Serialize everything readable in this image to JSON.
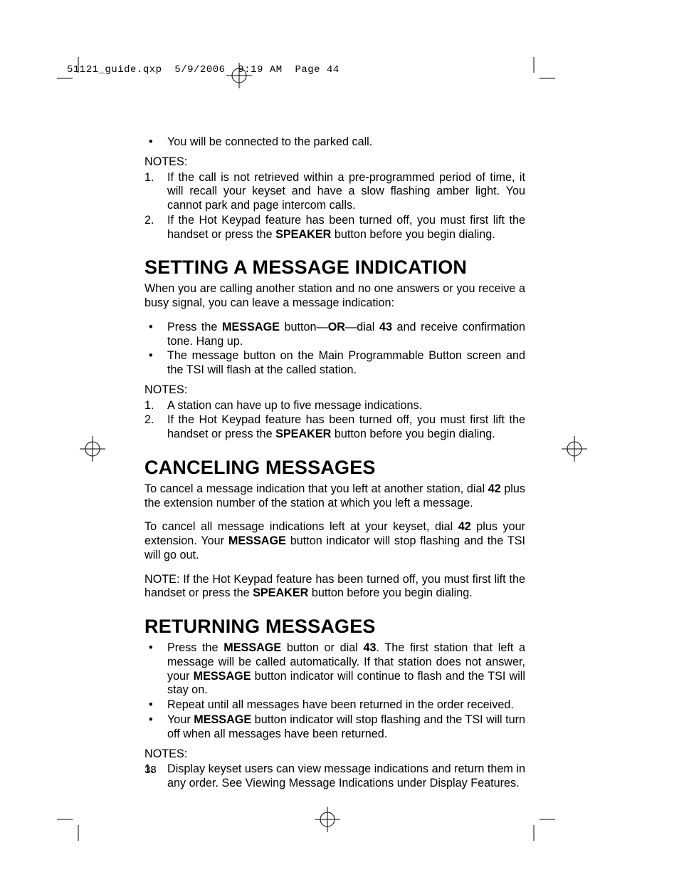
{
  "slug": "51121_guide.qxp  5/9/2006  9:19 AM  Page 44",
  "page_number": "38",
  "intro_bullets": [
    "You will be connected to the parked call."
  ],
  "intro_notes_label": "NOTES:",
  "intro_notes": [
    "If the call is not retrieved within a pre-programmed period of time, it will recall your keyset and have a slow flashing amber light. You cannot park and page intercom calls.",
    {
      "pre": "If the Hot Keypad feature has been turned off, you must first lift the handset or press the ",
      "bold": "SPEAKER",
      "post": " button before you begin dialing."
    }
  ],
  "sec1_title": "SETTING A MESSAGE INDICATION",
  "sec1_intro": "When you are calling another station and no one answers or you receive a busy signal, you can leave a message indication:",
  "sec1_bullets": [
    {
      "pre": "Press the ",
      "b1": "MESSAGE",
      "mid1": " button—",
      "b2": "OR",
      "mid2": "—dial ",
      "b3": "43",
      "post": " and receive confirmation tone. Hang up."
    },
    "The message button on the Main Programmable Button screen and the TSI will flash at the called station."
  ],
  "sec1_notes_label": "NOTES:",
  "sec1_notes": [
    "A station can have up to five message indications.",
    {
      "pre": "If the Hot Keypad feature has been turned off, you must first lift the handset or press the ",
      "bold": "SPEAKER",
      "post": " button before you begin dialing."
    }
  ],
  "sec2_title": "CANCELING MESSAGES",
  "sec2_p1": {
    "pre": "To cancel a message indication that you left at another station, dial ",
    "bold": "42",
    "post": " plus the extension number of the station at which you left a message."
  },
  "sec2_p2": {
    "pre": "To cancel all message indications left at your keyset, dial ",
    "b1": "42",
    "mid": " plus your extension. Your ",
    "b2": "MESSAGE",
    "post": " button indicator will stop flashing and the TSI will go out."
  },
  "sec2_note": {
    "pre": "NOTE: If the Hot Keypad feature has been turned off, you must first lift the handset or press the ",
    "bold": "SPEAKER",
    "post": " button before you begin dialing."
  },
  "sec3_title": "RETURNING MESSAGES",
  "sec3_bullets": [
    {
      "pre": "Press the ",
      "b1": "MESSAGE",
      "mid1": " button or dial ",
      "b2": "43",
      "mid2": ". The first station that left a message will be called automatically. If that station does not answer, your ",
      "b3": "MESSAGE",
      "post": " button indicator will continue to flash and the TSI will stay on."
    },
    "Repeat until all messages have been returned in the order received.",
    {
      "pre": "Your ",
      "b1": "MESSAGE",
      "post": " button indicator will stop flashing and the TSI will turn off when all messages have been returned."
    }
  ],
  "sec3_notes_label": "NOTES:",
  "sec3_notes": [
    "Display keyset users can view message indications and return them in any order. See Viewing Message Indications under Display Features."
  ]
}
